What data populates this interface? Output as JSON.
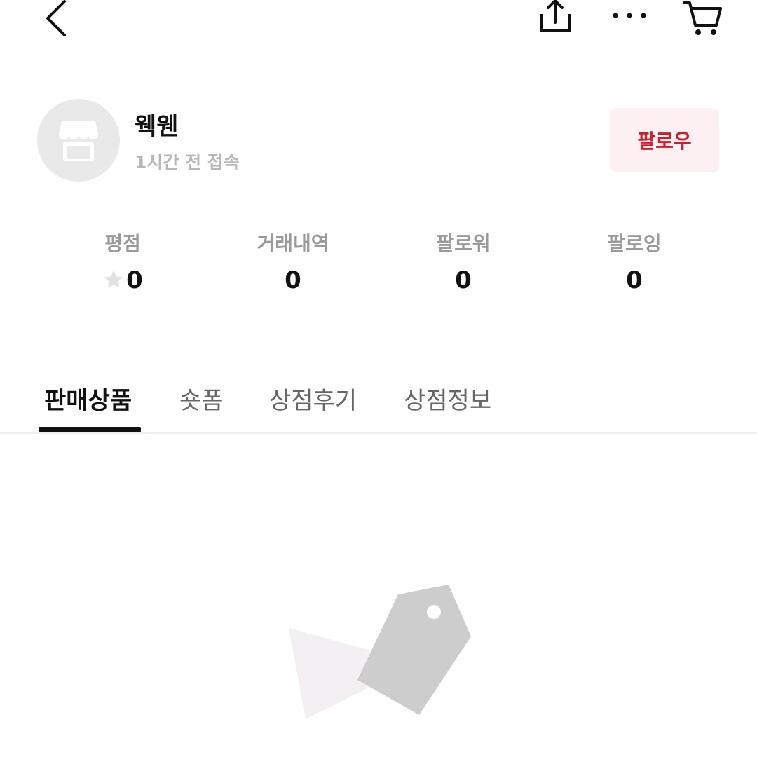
{
  "header": {
    "back_icon": "chevron-left-icon",
    "share_icon": "share-icon",
    "more_icon": "more-horizontal-icon",
    "cart_icon": "cart-icon"
  },
  "profile": {
    "avatar_icon": "store-icon",
    "name": "웩웬",
    "last_seen": "1시간 전 접속",
    "follow_label": "팔로우"
  },
  "stats": [
    {
      "label": "평점",
      "value": "0",
      "icon": "star-icon"
    },
    {
      "label": "거래내역",
      "value": "0"
    },
    {
      "label": "팔로워",
      "value": "0"
    },
    {
      "label": "팔로잉",
      "value": "0"
    }
  ],
  "tabs": [
    {
      "label": "판매상품",
      "active": true
    },
    {
      "label": "숏폼"
    },
    {
      "label": "상점후기"
    },
    {
      "label": "상점정보"
    }
  ],
  "empty_state": {
    "icon": "price-tag-illustration"
  },
  "colors": {
    "accent": "#d01d2d",
    "follow_bg": "#fdf0f2",
    "muted_text": "#9a9a9a",
    "avatar_bg": "#e9e9e9"
  }
}
